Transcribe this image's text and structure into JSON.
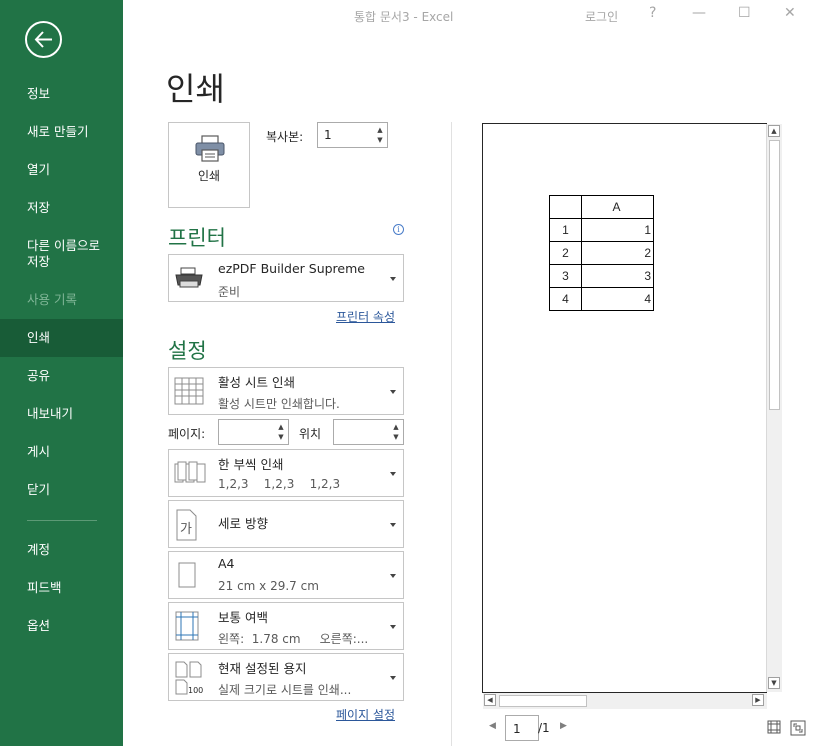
{
  "titlebar": {
    "title": "통합 문서3  -  Excel",
    "login": "로그인",
    "help": "?",
    "minimize": "—",
    "maximize": "☐",
    "close": "✕"
  },
  "sidebar": {
    "back_icon": "back-arrow-icon",
    "items": [
      {
        "label": "정보"
      },
      {
        "label": "새로 만들기"
      },
      {
        "label": "열기"
      },
      {
        "label": "저장"
      },
      {
        "label": "다른 이름으로\n저장"
      },
      {
        "label": "사용 기록",
        "disabled": true
      },
      {
        "label": "인쇄",
        "active": true
      },
      {
        "label": "공유"
      },
      {
        "label": "내보내기"
      },
      {
        "label": "게시"
      },
      {
        "label": "닫기"
      },
      {
        "label": "계정"
      },
      {
        "label": "피드백"
      },
      {
        "label": "옵션"
      }
    ]
  },
  "main": {
    "page_title": "인쇄",
    "print_button_label": "인쇄",
    "copies_label": "복사본:",
    "copies_value": "1",
    "printer_heading": "프린터",
    "printer_name": "ezPDF Builder Supreme",
    "printer_status": "준비",
    "printer_properties_link": "프린터 속성",
    "settings_heading": "설정",
    "print_what": {
      "title": "활성 시트 인쇄",
      "desc": "활성 시트만 인쇄합니다."
    },
    "pages_label": "페이지:",
    "pages_value": "",
    "to_label": "위치",
    "to_value": "",
    "collation": {
      "title": "한 부씩 인쇄",
      "desc": "1,2,3    1,2,3    1,2,3"
    },
    "orientation": {
      "title": "세로 방향"
    },
    "paper": {
      "title": "A4",
      "desc": "21 cm x 29.7 cm"
    },
    "margins": {
      "title": "보통 여백",
      "desc": "왼쪽:  1.78 cm     오른쪽:..."
    },
    "scaling": {
      "title": "현재 설정된 용지",
      "desc": "실제 크기로 시트를 인쇄..."
    },
    "page_setup_link": "페이지 설정"
  },
  "preview": {
    "column_header": "A",
    "rows": [
      {
        "row": "1",
        "value": "1"
      },
      {
        "row": "2",
        "value": "2"
      },
      {
        "row": "3",
        "value": "3"
      },
      {
        "row": "4",
        "value": "4"
      }
    ],
    "current_page": "1",
    "total_pages": "/1"
  },
  "colors": {
    "accent": "#217346",
    "sidebar_active": "#185c37",
    "link": "#2b579a"
  }
}
